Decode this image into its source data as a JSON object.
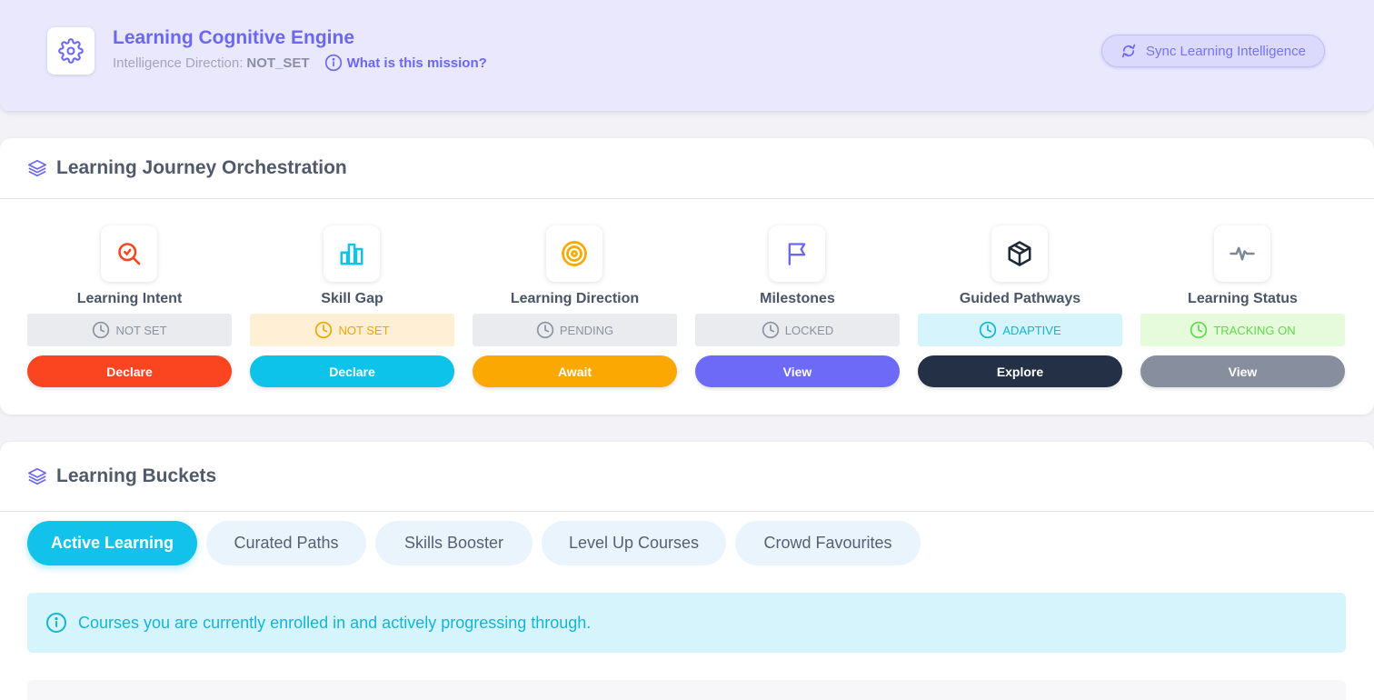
{
  "header": {
    "title": "Learning Cognitive Engine",
    "direction_label": "Intelligence Direction:",
    "direction_value": "NOT_SET",
    "mission_link": "What is this mission?",
    "sync_button": "Sync Learning Intelligence",
    "icon": "gear-icon"
  },
  "journey": {
    "title": "Learning Journey Orchestration",
    "icon": "layers-icon",
    "steps": [
      {
        "name": "Learning Intent",
        "icon": "search-chart-icon",
        "icon_color": "#fb4420",
        "status": "NOT SET",
        "status_bg": "#e9ebee",
        "status_color": "#8b93a0",
        "button": "Declare",
        "button_bg": "#fb4420"
      },
      {
        "name": "Skill Gap",
        "icon": "bar-chart-icon",
        "icon_color": "#12c2ea",
        "status": "NOT SET",
        "status_bg": "#feefd5",
        "status_color": "#f6a400",
        "button": "Declare",
        "button_bg": "#0ec3ea"
      },
      {
        "name": "Learning Direction",
        "icon": "target-icon",
        "icon_color": "#f9a900",
        "status": "PENDING",
        "status_bg": "#e9ebee",
        "status_color": "#8b93a0",
        "button": "Await",
        "button_bg": "#fca802"
      },
      {
        "name": "Milestones",
        "icon": "flag-icon",
        "icon_color": "#6b67f0",
        "status": "LOCKED",
        "status_bg": "#e9ebee",
        "status_color": "#8b93a0",
        "button": "View",
        "button_bg": "#6c6af6"
      },
      {
        "name": "Guided Pathways",
        "icon": "package-icon",
        "icon_color": "#1f2937",
        "status": "ADAPTIVE",
        "status_bg": "#d5f4fb",
        "status_color": "#13b5d8",
        "button": "Explore",
        "button_bg": "#233045"
      },
      {
        "name": "Learning Status",
        "icon": "activity-icon",
        "icon_color": "#7c8799",
        "status": "TRACKING ON",
        "status_bg": "#e5fbdc",
        "status_color": "#61d94a",
        "button": "View",
        "button_bg": "#878f9e"
      }
    ]
  },
  "buckets": {
    "title": "Learning Buckets",
    "icon": "layers-icon",
    "tabs": [
      {
        "label": "Active Learning",
        "active": true
      },
      {
        "label": "Curated Paths",
        "active": false
      },
      {
        "label": "Skills Booster",
        "active": false
      },
      {
        "label": "Level Up Courses",
        "active": false
      },
      {
        "label": "Crowd Favourites",
        "active": false
      }
    ],
    "info": "Courses you are currently enrolled in and actively progressing through."
  }
}
